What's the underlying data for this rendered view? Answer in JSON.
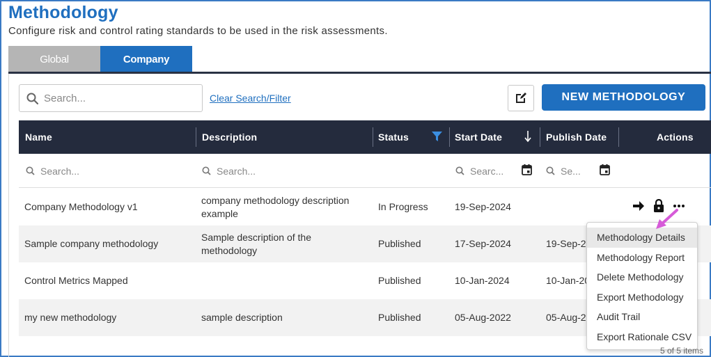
{
  "header": {
    "title": "Methodology",
    "subtitle": "Configure risk and control rating standards to be used in the risk assessments."
  },
  "tabs": [
    {
      "label": "Global",
      "active": false
    },
    {
      "label": "Company",
      "active": true
    }
  ],
  "toolbar": {
    "search_placeholder": "Search...",
    "clear_link": "Clear Search/Filter",
    "new_button": "NEW METHODOLOGY",
    "edit_icon": "edit-icon"
  },
  "table": {
    "columns": [
      "Name",
      "Description",
      "Status",
      "Start Date",
      "Publish Date",
      "Actions"
    ],
    "filter_placeholders": {
      "name": "Search...",
      "description": "Search...",
      "start_date": "Searc...",
      "publish_date": "Se..."
    },
    "rows": [
      {
        "name": "Company Methodology v1",
        "description": "company methodology description example",
        "status": "In Progress",
        "start_date": "19-Sep-2024",
        "publish_date": ""
      },
      {
        "name": "Sample company methodology",
        "description": "Sample description of the methodology",
        "status": "Published",
        "start_date": "17-Sep-2024",
        "publish_date": "19-Sep-2"
      },
      {
        "name": "Control Metrics Mapped",
        "description": "",
        "status": "Published",
        "start_date": "10-Jan-2024",
        "publish_date": "10-Jan-20"
      },
      {
        "name": "my new methodology",
        "description": "sample description",
        "status": "Published",
        "start_date": "05-Aug-2022",
        "publish_date": "05-Aug-2"
      }
    ]
  },
  "context_menu": {
    "items": [
      "Methodology Details",
      "Methodology Report",
      "Delete Methodology",
      "Export Methodology",
      "Audit Trail",
      "Export Rationale CSV"
    ],
    "highlighted": "Methodology Details"
  },
  "footer": {
    "items_text": "5 of 5 items"
  },
  "colors": {
    "accent": "#1f6fbf",
    "header_bg": "#242b3d",
    "annotation_arrow": "#d65bd8"
  }
}
